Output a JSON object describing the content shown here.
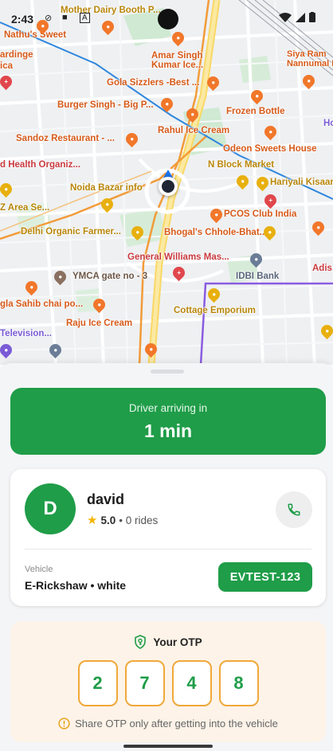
{
  "status_bar": {
    "time": "2:43"
  },
  "map": {
    "pois": [
      {
        "id": "mother-dairy",
        "label": "Mother Dairy Booth P...",
        "kind": "shop"
      },
      {
        "id": "nathus-sweet",
        "label": "Nathu's Sweet",
        "kind": "food"
      },
      {
        "id": "bardinge",
        "label": "ardinge",
        "kind": "food"
      },
      {
        "id": "ica",
        "label": "ica",
        "kind": "food"
      },
      {
        "id": "amar-singh",
        "label": "Amar Singh\nKumar Ice...",
        "kind": "food"
      },
      {
        "id": "siya-ram",
        "label": "Siya Ram\nNannumal Ka...",
        "kind": "food"
      },
      {
        "id": "gola-sizzlers",
        "label": "Gola Sizzlers -Best ...",
        "kind": "food"
      },
      {
        "id": "burger-singh",
        "label": "Burger Singh - Big P...",
        "kind": "food"
      },
      {
        "id": "frozen-bottle",
        "label": "Frozen Bottle",
        "kind": "food"
      },
      {
        "id": "rahul-ice-cream",
        "label": "Rahul Ice Cream",
        "kind": "food"
      },
      {
        "id": "sandoz",
        "label": "Sandoz Restaurant - ...",
        "kind": "food"
      },
      {
        "id": "odeon-sweets",
        "label": "Odeon Sweets House",
        "kind": "food"
      },
      {
        "id": "health-org",
        "label": "d Health Organiz...",
        "kind": "med"
      },
      {
        "id": "n-block",
        "label": "N Block Market",
        "kind": "shop"
      },
      {
        "id": "hariyali",
        "label": "Hariyali Kisaan",
        "kind": "shop"
      },
      {
        "id": "noida-bazar",
        "label": "Noida Bazar info",
        "kind": "shop"
      },
      {
        "id": "z-area",
        "label": "Z Area Se...",
        "kind": "shop"
      },
      {
        "id": "pcos-club",
        "label": "PCOS Club India",
        "kind": "food"
      },
      {
        "id": "delhi-organic",
        "label": "Delhi Organic Farmer...",
        "kind": "shop"
      },
      {
        "id": "bhogals",
        "label": "Bhogal's Chhole-Bhat...",
        "kind": "food"
      },
      {
        "id": "general-williams",
        "label": "General Williams Mas...",
        "kind": "med"
      },
      {
        "id": "adis",
        "label": "Adis",
        "kind": "med"
      },
      {
        "id": "ymca",
        "label": "YMCA gate no - 3",
        "kind": "misc"
      },
      {
        "id": "idbi-bank",
        "label": "IDBI Bank",
        "kind": "bank"
      },
      {
        "id": "sahib-chai",
        "label": "gla Sahib chai po...",
        "kind": "food"
      },
      {
        "id": "cottage-emporium",
        "label": "Cottage Emporium",
        "kind": "shop"
      },
      {
        "id": "raju-ice-cream",
        "label": "Raju Ice Cream",
        "kind": "food"
      },
      {
        "id": "television",
        "label": "Television...",
        "kind": "purple"
      },
      {
        "id": "ho",
        "label": "Ho",
        "kind": "purple"
      }
    ]
  },
  "arrival": {
    "label": "Driver arriving in",
    "eta": "1 min"
  },
  "driver": {
    "initial": "D",
    "name": "david",
    "rating": "5.0",
    "rides": "• 0 rides",
    "vehicle_label": "Vehicle",
    "vehicle_desc": "E-Rickshaw • white",
    "plate": "EVTEST-123"
  },
  "otp": {
    "title": "Your OTP",
    "digits": [
      "2",
      "7",
      "4",
      "8"
    ],
    "note": "Share OTP only after getting into the vehicle"
  },
  "colors": {
    "primary_green": "#1f9d48",
    "otp_border": "#f0a83a",
    "otp_bg": "#fdf3e8",
    "route_blue": "#2e86de",
    "route_orange": "#f29b38"
  },
  "icons": [
    "call-icon",
    "shield-key-icon",
    "alert-icon",
    "star-icon",
    "location-arrow-icon"
  ]
}
